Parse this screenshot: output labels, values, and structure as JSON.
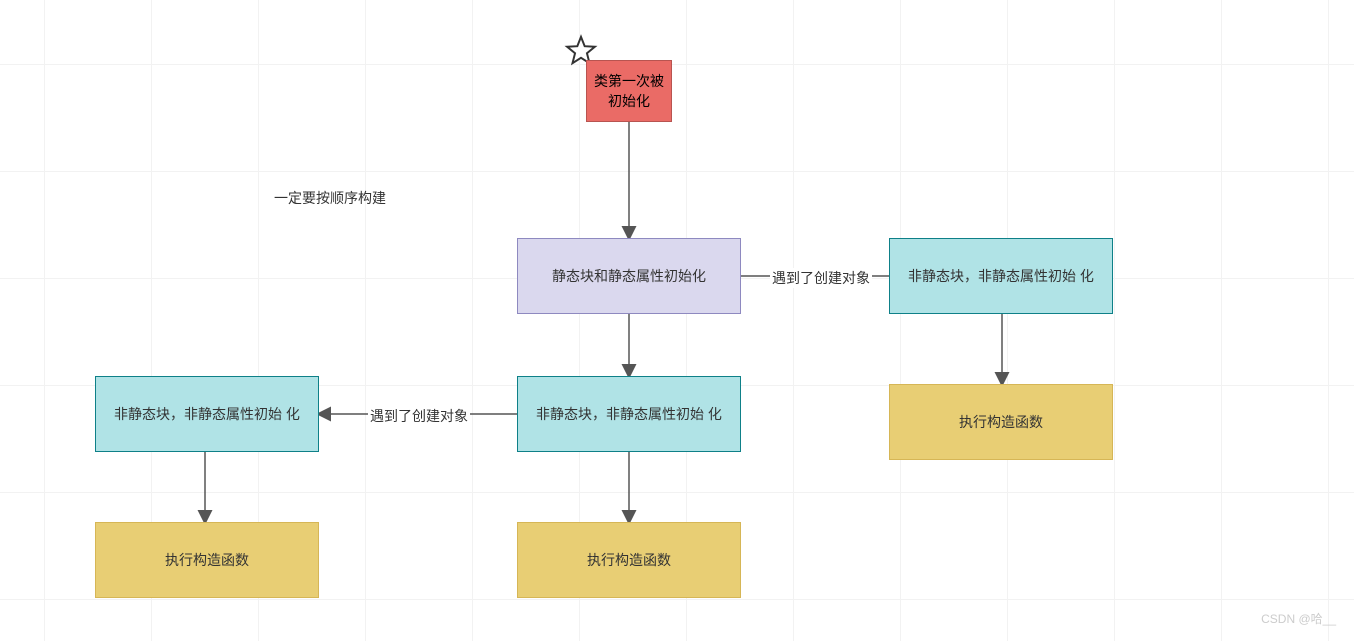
{
  "nodes": {
    "start": "类第一次被\n初始化",
    "static_init": "静态块和静态属性初始化",
    "nonstatic_mid": "非静态块，非静态属性初始\n化",
    "nonstatic_left": "非静态块，非静态属性初始\n化",
    "nonstatic_right": "非静态块，非静态属性初始\n化",
    "ctor_mid": "执行构造函数",
    "ctor_left": "执行构造函数",
    "ctor_right": "执行构造函数"
  },
  "labels": {
    "tip": "一定要按顺序构建",
    "edge_mid_left": "遇到了创建对象",
    "edge_top_right": "遇到了创建对象"
  },
  "watermark": "CSDN @哈__"
}
